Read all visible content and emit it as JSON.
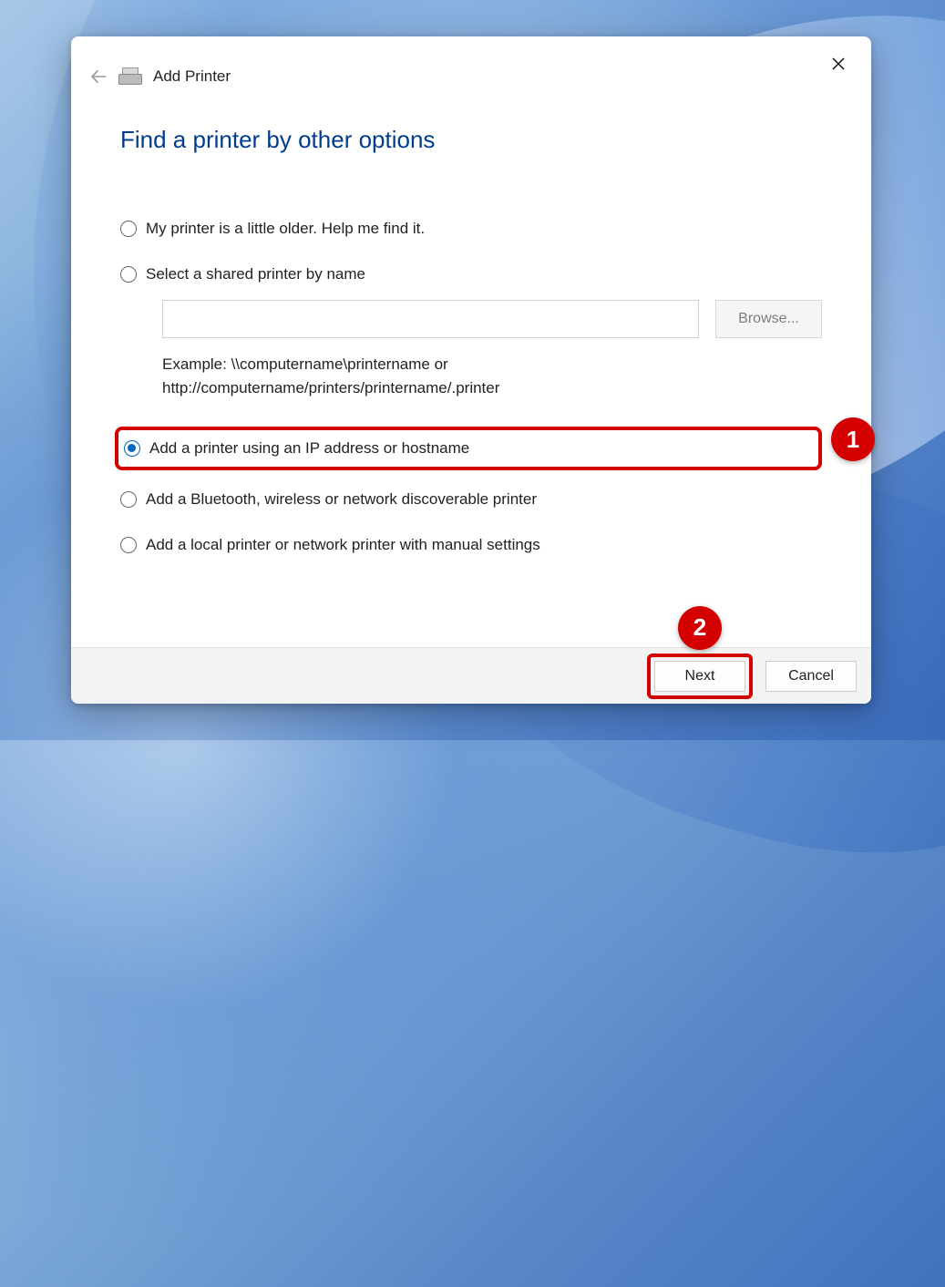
{
  "window": {
    "title": "Add Printer"
  },
  "heading": "Find a printer by other options",
  "options": {
    "o1": "My printer is a little older. Help me find it.",
    "o2": "Select a shared printer by name",
    "o3": "Add a printer using an IP address or hostname",
    "o4": "Add a Bluetooth, wireless or network discoverable printer",
    "o5": "Add a local printer or network printer with manual settings"
  },
  "shared_input": {
    "value": "",
    "browse_label": "Browse...",
    "example_line1": "Example: \\\\computername\\printername or",
    "example_line2": "http://computername/printers/printername/.printer"
  },
  "footer": {
    "next": "Next",
    "cancel": "Cancel"
  },
  "annotations": {
    "step1": "1",
    "step2": "2"
  },
  "colors": {
    "heading": "#003d8a",
    "accent": "#0067c0",
    "annotation": "#d40000"
  }
}
